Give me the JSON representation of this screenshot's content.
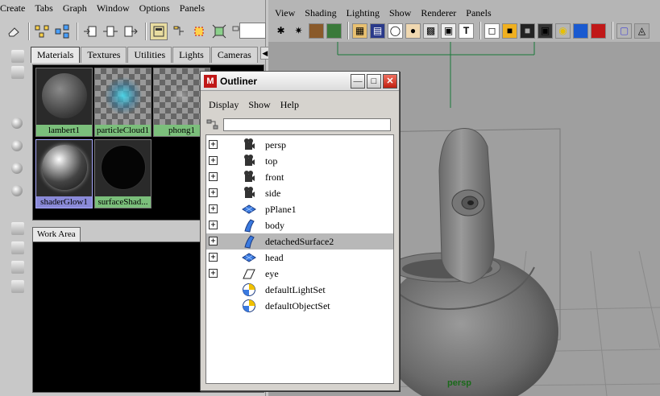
{
  "hypershade": {
    "menu": [
      "Create",
      "Tabs",
      "Graph",
      "Window",
      "Options",
      "Panels"
    ],
    "tabs": [
      "Materials",
      "Textures",
      "Utilities",
      "Lights",
      "Cameras"
    ],
    "active_tab": "Materials",
    "shaders": [
      {
        "name": "lambert1",
        "kind": "grey-sphere"
      },
      {
        "name": "particleCloud1",
        "kind": "cloud"
      },
      {
        "name": "phong1",
        "kind": "checker"
      },
      {
        "name": "shaderGlow1",
        "kind": "glow-sphere",
        "selected": true
      },
      {
        "name": "surfaceShad...",
        "kind": "black-sphere"
      }
    ],
    "work_area_tab": "Work Area"
  },
  "viewport": {
    "menu": [
      "View",
      "Shading",
      "Lighting",
      "Show",
      "Renderer",
      "Panels"
    ],
    "camera_label": "persp",
    "camera_label_color": "#1a6a1a"
  },
  "outliner": {
    "title": "Outliner",
    "menu": [
      "Display",
      "Show",
      "Help"
    ],
    "items": [
      {
        "label": "persp",
        "icon": "camera-icon",
        "expandable": true
      },
      {
        "label": "top",
        "icon": "camera-icon",
        "expandable": true
      },
      {
        "label": "front",
        "icon": "camera-icon",
        "expandable": true
      },
      {
        "label": "side",
        "icon": "camera-icon",
        "expandable": true
      },
      {
        "label": "pPlane1",
        "icon": "nurbs-plane-icon",
        "expandable": true
      },
      {
        "label": "body",
        "icon": "surface-icon",
        "expandable": true
      },
      {
        "label": "detachedSurface2",
        "icon": "surface-icon",
        "expandable": true,
        "selected": true
      },
      {
        "label": "head",
        "icon": "nurbs-plane-icon",
        "expandable": true
      },
      {
        "label": "eye",
        "icon": "curve-icon",
        "expandable": true
      },
      {
        "label": "defaultLightSet",
        "icon": "set-icon",
        "expandable": false
      },
      {
        "label": "defaultObjectSet",
        "icon": "set-icon",
        "expandable": false
      }
    ],
    "expander_symbol": "+"
  },
  "colors": {
    "selection_row": "#b8b8b8",
    "shader_caption": "#7bbf7b",
    "shader_caption_selected": "#8a8ad8"
  }
}
